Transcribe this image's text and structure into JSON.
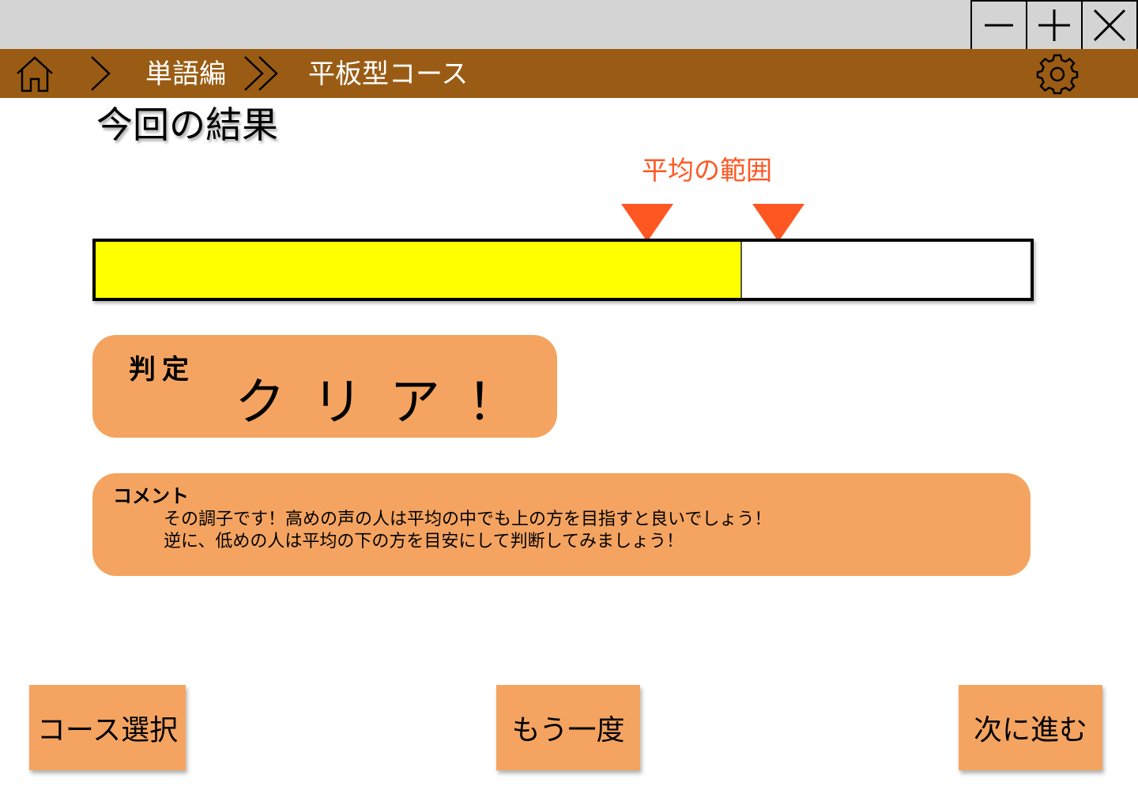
{
  "window": {
    "controls": [
      "minimize",
      "maximize",
      "close"
    ]
  },
  "nav": {
    "breadcrumb_1": "単語編",
    "breadcrumb_2": "平板型コース"
  },
  "page": {
    "title": "今回の結果"
  },
  "result": {
    "average_label": "平均の範囲",
    "score_fraction": 0.69,
    "average_range": [
      0.59,
      0.73
    ],
    "bar_fill_color": "#ffff00",
    "marker_color": "#ff5722"
  },
  "verdict": {
    "label": "判定",
    "value": "クリア！"
  },
  "comment": {
    "label": "コメント",
    "lines": [
      "その調子です！高めの声の人は平均の中でも上の方を目指すと良いでしょう！",
      "逆に、低めの人は平均の下の方を目安にして判断してみましょう！"
    ]
  },
  "buttons": {
    "course_select": "コース選択",
    "retry": "もう一度",
    "next": "次に進む"
  },
  "colors": {
    "titlebar": "#d4d4d4",
    "navbar": "#9a5c14",
    "panel": "#f4a460",
    "accent": "#ff5722"
  }
}
